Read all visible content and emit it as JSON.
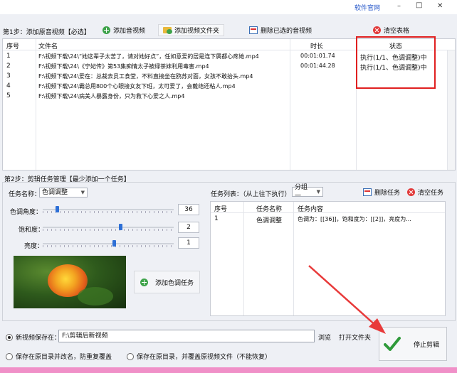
{
  "colors": {
    "accent": "#2d6fd6",
    "highlight_box": "#e02020",
    "arrow": "#e83a3a",
    "bottom_strip": "#f090c8"
  },
  "titlebar": {
    "website_label": "软件官网",
    "minimize": "–",
    "maximize": "□",
    "close": "✕"
  },
  "step1": {
    "label": "第1步：添加原音视频【必选】",
    "add_video": "添加音视频",
    "add_folder": "添加视频文件夹",
    "delete_selected": "删除已选的音视频",
    "clear_table": "清空表格"
  },
  "file_table": {
    "headers": {
      "index": "序号",
      "filename": "文件名",
      "duration": "时长",
      "status": "状态"
    },
    "rows": [
      {
        "index": "1",
        "filename": "F:\\视频下载\\24\\“她这辈子太苦了，请对她好点”，任如意爱的居是连下属都心疼她.mp4",
        "duration": "00:01:01.74",
        "status": "执行(1/1、色调调整)中"
      },
      {
        "index": "2",
        "filename": "F:\\视频下载\\24\\《宁妃传》第53集痴情太子被绿茶妹利用毒害.mp4",
        "duration": "00:01:44.28",
        "status": "执行(1/1、色调调整)中"
      },
      {
        "index": "3",
        "filename": "F:\\视频下载\\24\\爱在：总裁去员工食堂，不料直接坐在鸥苏对面，女孩不敢抬头.mp4",
        "duration": "",
        "status": ""
      },
      {
        "index": "4",
        "filename": "F:\\视频下载\\24\\霸总用800个心眼接女友下班，太可爱了，会戴结还粘人.mp4",
        "duration": "",
        "status": ""
      },
      {
        "index": "5",
        "filename": "F:\\视频下载\\24\\病美人暴露身份，只为救下心爱之人.mp4",
        "duration": "",
        "status": ""
      }
    ]
  },
  "step2": {
    "label": "第2步：剪辑任务管理【最少添加一个任务】",
    "task_name_label": "任务名称：",
    "task_name_value": "色调调整",
    "hue_label": "色调角度：",
    "hue_value": "36",
    "hue_level": 0.1,
    "saturation_label": "饱和度：",
    "saturation_value": "2",
    "saturation_level": 0.6,
    "brightness_label": "亮度：",
    "brightness_value": "1",
    "brightness_level": 0.55,
    "add_task_button": "添加色调任务",
    "task_list_label": "任务列表：（从上往下执行）",
    "group_value": "分组一",
    "delete_task": "删除任务",
    "clear_task": "清空任务",
    "task_table": {
      "headers": {
        "index": "序号",
        "name": "任务名称",
        "content": "任务内容"
      },
      "rows": [
        {
          "index": "1",
          "name": "色调调整",
          "content": "色调为：[[36]]，饱和度为：[[2]]，亮度为..."
        }
      ]
    }
  },
  "output": {
    "new_save_label": "新视频保存在：",
    "save_path": "F:\\剪辑后新视频",
    "browse": "浏览",
    "open_folder": "打开文件夹",
    "option_rename": "保存在原目录并改名，防重复覆盖",
    "option_overwrite": "保存在原目录，并覆盖原视频文件（不能恢复）",
    "stop_button": "停止剪辑"
  }
}
